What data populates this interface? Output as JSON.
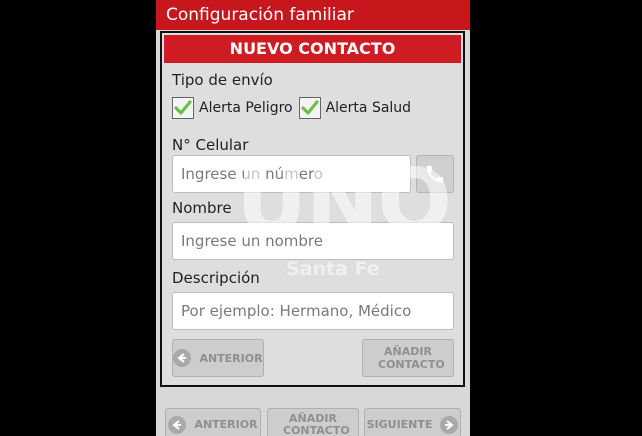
{
  "app": {
    "title": "Configuración familiar"
  },
  "dialog": {
    "title": "NUEVO CONTACTO",
    "tipo_label": "Tipo de envío",
    "checkboxes": [
      {
        "label": "Alerta Peligro",
        "checked": true
      },
      {
        "label": "Alerta Salud",
        "checked": true
      }
    ],
    "celular_label": "N° Celular",
    "celular_placeholder": "Ingrese un número",
    "nombre_label": "Nombre",
    "nombre_placeholder": "Ingrese un nombre",
    "descripcion_label": "Descripción",
    "descripcion_placeholder": "Por ejemplo: Hermano, Médico",
    "back_label": "ANTERIOR",
    "add_label": "AÑADIR CONTACTO"
  },
  "bottom": {
    "back_label": "ANTERIOR",
    "add_label": "AÑADIR CONTACTO",
    "next_label": "SIGUIENTE"
  },
  "watermark": {
    "brand": "UNO",
    "city": "Santa Fe"
  },
  "colors": {
    "accent": "#c8161d",
    "check": "#6cc04a"
  }
}
